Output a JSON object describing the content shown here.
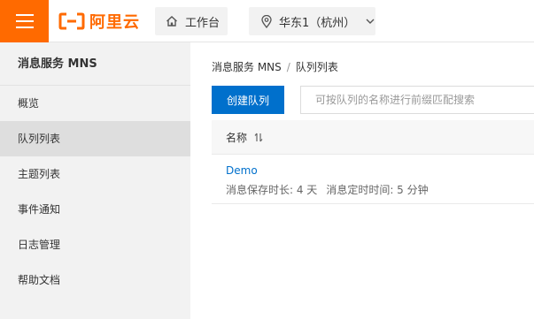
{
  "topbar": {
    "logo_text": "阿里云",
    "workbench_label": "工作台",
    "region_label": "华东1（杭州）",
    "brand_color": "#ff6a00",
    "icons": [
      "menu-icon",
      "aliyun-logo-icon",
      "home-icon",
      "location-pin-icon",
      "chevron-down-icon"
    ]
  },
  "sidebar": {
    "title": "消息服务 MNS",
    "items": [
      {
        "label": "概览",
        "active": false
      },
      {
        "label": "队列列表",
        "active": true
      },
      {
        "label": "主题列表",
        "active": false
      },
      {
        "label": "事件通知",
        "active": false
      },
      {
        "label": "日志管理",
        "active": false
      },
      {
        "label": "帮助文档",
        "active": false
      }
    ]
  },
  "main": {
    "breadcrumb": {
      "root": "消息服务 MNS",
      "separator": "/",
      "current": "队列列表"
    },
    "create_button_label": "创建队列",
    "search_placeholder": "可按队列的名称进行前缀匹配搜索",
    "search_value": "",
    "accent_color": "#0070cc",
    "table": {
      "column_name": "名称",
      "rows": [
        {
          "name": "Demo",
          "retention": "消息保存时长: 4 天",
          "delay": "消息定时时间: 5 分钟"
        }
      ]
    }
  }
}
